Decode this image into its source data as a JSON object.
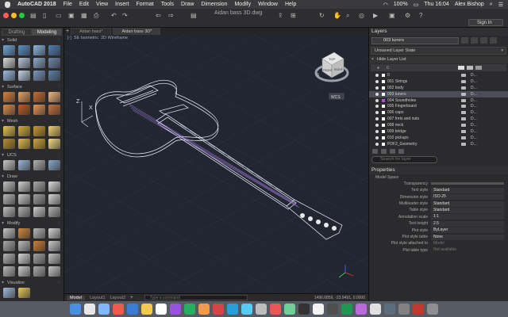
{
  "menubar": {
    "app": "AutoCAD 2018",
    "items": [
      "File",
      "Edit",
      "View",
      "Insert",
      "Format",
      "Tools",
      "Draw",
      "Dimension",
      "Modify",
      "Window",
      "Help"
    ],
    "battery": "100%",
    "clock": "Thu 16:04",
    "user": "Alex Bishop"
  },
  "titlebar": {
    "document": "Aidan bass 3D.dwg",
    "sign_in": "Sign In"
  },
  "tool_palette": {
    "tabs": [
      "Drafting",
      "Modeling"
    ],
    "active_tab": "Modeling",
    "sections": [
      {
        "name": "Solid",
        "colors": [
          "#6fa6d6",
          "#5b8fc4",
          "#8bb7e0",
          "#4e7fb3",
          "#d9d9d9",
          "#b8c6d8",
          "#8fa9c8",
          "#6d88a9",
          "#9cbbe0",
          "#c2d3e6",
          "#7b97bd",
          "#5f7fa6"
        ]
      },
      {
        "name": "Surface",
        "colors": [
          "#d9803e",
          "#e7a05f",
          "#c66d2e",
          "#f0b57a",
          "#d98a4b",
          "#b95e24",
          "#e49455",
          "#c8743a"
        ]
      },
      {
        "name": "Mesh",
        "colors": [
          "#e6c34f",
          "#d4ad35",
          "#c99a2a",
          "#f0d26a",
          "#b8902a",
          "#e0bb45",
          "#cfa535",
          "#f2dc80"
        ]
      },
      {
        "name": "UCS",
        "colors": [
          "#c8c8c8",
          "#9ab7d8",
          "#b0b0b0",
          "#8aa8cc"
        ]
      },
      {
        "name": "Draw",
        "colors": [
          "#bfbfbf",
          "#cfcfcf",
          "#a9a9a9",
          "#dcdcdc",
          "#b5b5b5",
          "#c9c9c9",
          "#9e9e9e",
          "#d4d4d4",
          "#bdbdbd",
          "#adadad",
          "#cccccc",
          "#b0b0b0"
        ]
      },
      {
        "name": "Modify",
        "colors": [
          "#c4c4c4",
          "#d08a3b",
          "#b7b7b7",
          "#d3d3d3",
          "#a8a8a8",
          "#bcbcbc",
          "#cf7f35",
          "#c9c9c9",
          "#b2b2b2",
          "#d6d6d6",
          "#a2a2a2",
          "#c0c0c0",
          "#b9b9b9",
          "#cdcdcd",
          "#aaaaaa",
          "#c6c6c6"
        ]
      },
      {
        "name": "Visualize",
        "colors": [
          "#9fb8d9",
          "#e6c95a"
        ]
      }
    ]
  },
  "doc_tabs": [
    "Aidan bass*",
    "Aidan bass 3D*"
  ],
  "viewport": {
    "view": "SE Isometric",
    "visual_style": "2D Wireframe",
    "wcs": "WCS",
    "viewcube": {
      "top": "TOP",
      "front": "FRONT",
      "right": "RIGHT"
    },
    "axis_z": "Z",
    "axis_x": "X"
  },
  "bottom": {
    "tabs": [
      "Model",
      "Layout1",
      "Layout2"
    ],
    "active_tab": "Model",
    "command_placeholder": "Type a command",
    "coords": "1496.6859, -23.9491, 0.0000"
  },
  "layers": {
    "title": "Layers",
    "current": "003 tuners",
    "state": "Unsaved Layer State",
    "hide_list": "Hide Layer List",
    "header_default": "0",
    "rows": [
      {
        "name": "0",
        "color": "#ffffff",
        "d": "D..."
      },
      {
        "name": "001 Strings",
        "color": "#ffffff",
        "d": "D..."
      },
      {
        "name": "002 body",
        "color": "#ffffff",
        "d": "D..."
      },
      {
        "name": "003 tuners",
        "color": "#ffffff",
        "d": "D..."
      },
      {
        "name": "004 Soundholes",
        "color": "#b050d0",
        "d": "D..."
      },
      {
        "name": "005 Fingerboard",
        "color": "#ffffff",
        "d": "D..."
      },
      {
        "name": "006 capo",
        "color": "#ffffff",
        "d": "D..."
      },
      {
        "name": "007 frets and nuts",
        "color": "#ffffff",
        "d": "D..."
      },
      {
        "name": "008 neck",
        "color": "#ffffff",
        "d": "D..."
      },
      {
        "name": "009 bridge",
        "color": "#ffffff",
        "d": "D..."
      },
      {
        "name": "010 pickups",
        "color": "#ffffff",
        "d": "D..."
      },
      {
        "name": "PDF2_Geometry",
        "color": "#ffffff",
        "d": "D..."
      }
    ],
    "selected": "003 tuners",
    "search_placeholder": "Search for layer"
  },
  "properties": {
    "title": "Properties",
    "scope": "Model Space",
    "transparency_label": "Transparency",
    "rows": [
      {
        "k": "Text style",
        "v": "Standard"
      },
      {
        "k": "Dimension style",
        "v": "ISO-25"
      },
      {
        "k": "Multileader style",
        "v": "Standard"
      },
      {
        "k": "Table style",
        "v": "Standard"
      },
      {
        "k": "Annotation scale",
        "v": "1:1"
      },
      {
        "k": "Text height",
        "v": "2.5"
      },
      {
        "k": "Plot style",
        "v": "ByLayer"
      },
      {
        "k": "Plot style table",
        "v": "None"
      },
      {
        "k": "Plot style attached to",
        "v": "Model",
        "dim": true
      },
      {
        "k": "Plot table type",
        "v": "Not available",
        "dim": true
      }
    ]
  },
  "dock": {
    "colors": [
      "#4a90e2",
      "#e8e8e8",
      "#7fb8ff",
      "#f05a4a",
      "#3a7bd5",
      "#f2c94c",
      "#ffffff",
      "#9b51e0",
      "#27ae60",
      "#f2994a",
      "#d64545",
      "#2d9cdb",
      "#56ccf2",
      "#bdbdbd",
      "#eb5757",
      "#6fcf97",
      "#333333",
      "#f2f2f2",
      "#4f4f4f",
      "#219653",
      "#bb6bd9",
      "#e0e0e0",
      "#5d6d7e",
      "#828282",
      "#c0392b",
      "#8e8e93"
    ]
  }
}
